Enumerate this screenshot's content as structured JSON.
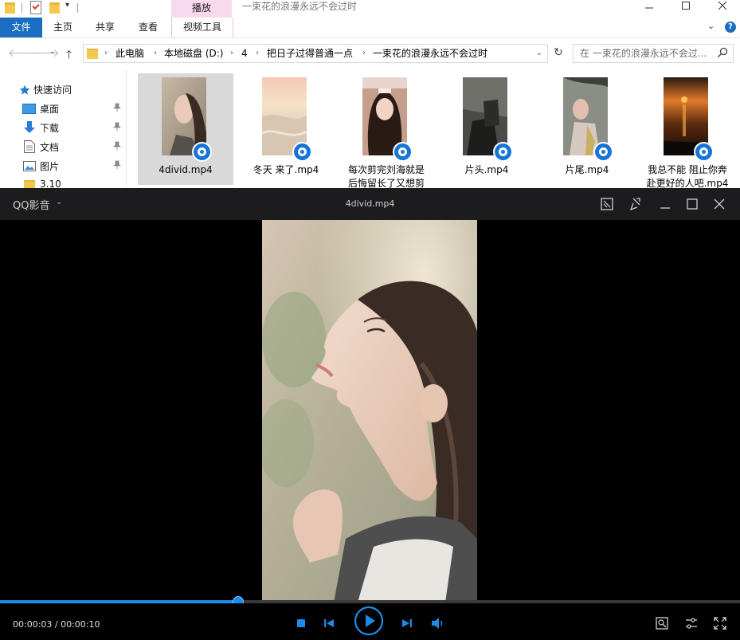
{
  "explorer": {
    "window_title": "一束花的浪漫永远不会过时",
    "context_tab_header": "播放",
    "ribbon_tabs": [
      "文件",
      "主页",
      "共享",
      "查看",
      "视频工具"
    ],
    "address": {
      "crumbs": [
        "此电脑",
        "本地磁盘 (D:)",
        "4",
        "把日子过得普通一点",
        "一束花的浪漫永远不会过时"
      ]
    },
    "search": {
      "placeholder": "在 一束花的浪漫永远不会过..."
    },
    "sidebar": {
      "items": [
        {
          "label": "快速访问",
          "icon": "star-icon"
        },
        {
          "label": "桌面",
          "icon": "desktop-icon",
          "pinned": true
        },
        {
          "label": "下载",
          "icon": "download-icon",
          "pinned": true
        },
        {
          "label": "文档",
          "icon": "document-icon",
          "pinned": true
        },
        {
          "label": "图片",
          "icon": "pictures-icon",
          "pinned": true
        },
        {
          "label": "3.10",
          "icon": "folder-icon"
        }
      ]
    },
    "files": [
      {
        "name": "4divid.mp4",
        "selected": true
      },
      {
        "name": "冬天  来了.mp4",
        "selected": false
      },
      {
        "name": "每次剪完刘海就是\n后悔留长了又想剪",
        "selected": false
      },
      {
        "name": "片头.mp4",
        "selected": false
      },
      {
        "name": "片尾.mp4",
        "selected": false
      },
      {
        "name": "我总不能  阻止你奔\n赴更好的人吧.mp4",
        "selected": false
      }
    ],
    "colors": {
      "accent": "#1a6dc1",
      "context_tab": "#f9d9ec",
      "selection": "#cce8ff"
    }
  },
  "player": {
    "app_name": "QQ影音",
    "file_name": "4divid.mp4",
    "time_current": "00:00:03",
    "time_total": "00:00:10",
    "time_display": "00:00:03 / 00:00:10",
    "progress_fraction": 0.322,
    "colors": {
      "accent": "#1d8ce8",
      "titlebar": "#1c1c1e"
    }
  }
}
